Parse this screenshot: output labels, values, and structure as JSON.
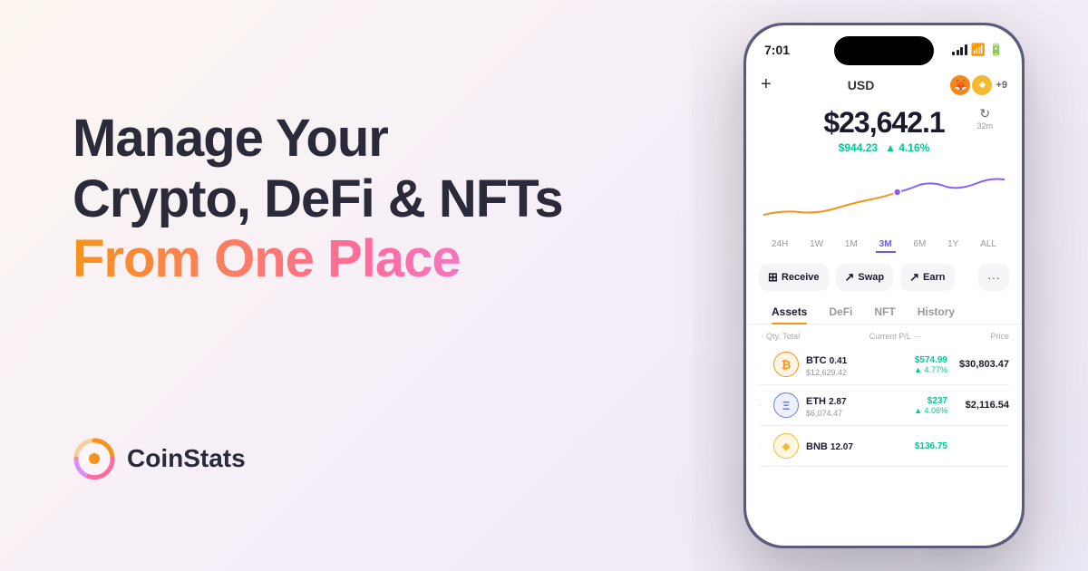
{
  "background": {
    "gradient_start": "#fdf6f0",
    "gradient_end": "#ede8f5"
  },
  "headline": {
    "line1": "Manage Your",
    "line2": "Crypto, DeFi & NFTs",
    "line3": "From One Place"
  },
  "brand": {
    "name": "CoinStats",
    "icon_color_primary": "#f7931a",
    "icon_color_secondary": "#ff6b9d"
  },
  "phone": {
    "status_time": "7:01",
    "currency": "USD",
    "wallet_count": "+9",
    "portfolio_amount": "$23,642.1",
    "refresh_time": "32m",
    "change_amount": "$944.23",
    "change_percent": "▲ 4.16%",
    "time_filters": [
      "24H",
      "1W",
      "1M",
      "3M",
      "6M",
      "1Y",
      "ALL"
    ],
    "active_filter": "3M",
    "actions": [
      {
        "label": "Receive",
        "icon": "⊞"
      },
      {
        "label": "Swap",
        "icon": "↗"
      },
      {
        "label": "Earn",
        "icon": "↗"
      }
    ],
    "tabs": [
      "Assets",
      "DeFi",
      "NFT",
      "History"
    ],
    "active_tab": "Assets",
    "table_headers": {
      "left": "Qty. Total",
      "center": "Current P/L",
      "right": "Price"
    },
    "assets": [
      {
        "rank": "·",
        "symbol": "BTC",
        "qty": "0.41",
        "usd_value": "$12,629.42",
        "icon_color": "#f7931a",
        "icon_text": "₿",
        "pnl_amount": "$574.99",
        "pnl_percent": "▲ 4.77%",
        "price": "$30,803.47"
      },
      {
        "rank": "·",
        "symbol": "ETH",
        "qty": "2.87",
        "usd_value": "$6,074.47",
        "icon_color": "#627eea",
        "icon_text": "Ξ",
        "pnl_amount": "$237",
        "pnl_percent": "▲ 4.06%",
        "price": "$2,116.54"
      },
      {
        "rank": "·",
        "symbol": "BNB",
        "qty": "12.07",
        "usd_value": "",
        "icon_color": "#f3ba2f",
        "icon_text": "B",
        "pnl_amount": "$136.75",
        "pnl_percent": "",
        "price": ""
      }
    ],
    "chart": {
      "line_color_orange": "#f7931a",
      "line_color_purple": "#8b5cf6",
      "dot_color": "#8b5cf6"
    }
  }
}
